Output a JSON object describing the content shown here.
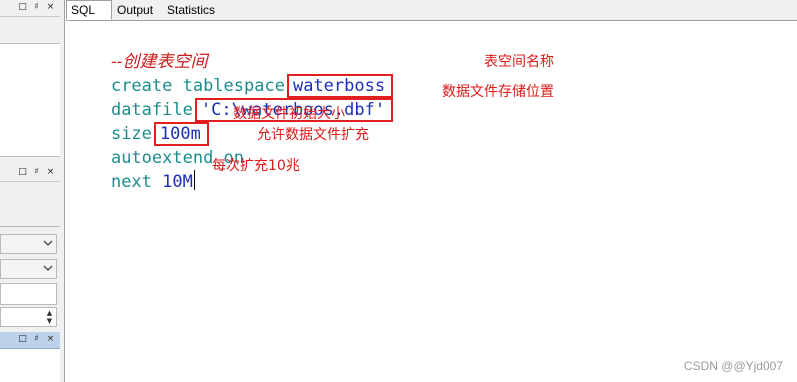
{
  "tabs": [
    {
      "label": "SQL",
      "active": true
    },
    {
      "label": "Output",
      "active": false
    },
    {
      "label": "Statistics",
      "active": false
    }
  ],
  "left_panel": {
    "header_buttons": [
      "□",
      "♯",
      "×"
    ]
  },
  "editor": {
    "comment": "--创建表空间",
    "line1_keywords": "create tablespace",
    "line1_value": "waterboss",
    "line2_keyword": "datafile",
    "line2_value": "'C:\\waterboos.dbf'",
    "line3_keyword": "size",
    "line3_value": "100m",
    "line4_keywords": "autoextend on",
    "line5_keyword": "next",
    "line5_value": "10M"
  },
  "annotations": {
    "tablespace_name": "表空间名称",
    "datafile_location": "数据文件存储位置",
    "initial_size": "数据文件初始大小",
    "autoextend": "允许数据文件扩充",
    "next_size": "每次扩充10兆"
  },
  "watermark": "CSDN @@Yjd007",
  "colors": {
    "keyword": "#1e8c8c",
    "value": "#1c2fb5",
    "comment": "#cc1d1d",
    "annotation": "#e01818",
    "highlight_box": "#e02020"
  }
}
